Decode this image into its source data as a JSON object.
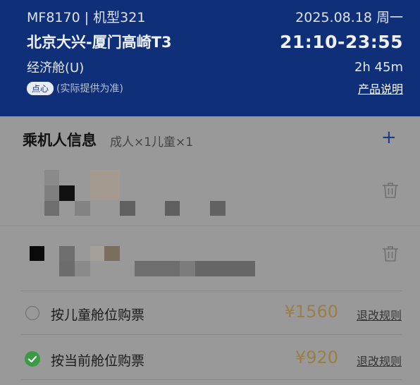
{
  "flight": {
    "number_model": "MF8170 | 机型321",
    "date": "2025.08.18 周一",
    "route": "北京大兴-厦门高崎T3",
    "time": "21:10-23:55",
    "cabin": "经济舱(U)",
    "duration": "2h 45m",
    "meal_badge": "点心",
    "meal_note": "(实际提供为准)",
    "product_link": "产品说明"
  },
  "passengers": {
    "title": "乘机人信息",
    "summary": "成人×1儿童×1",
    "add_icon": "plus-icon",
    "delete_icon": "trash-icon"
  },
  "options": [
    {
      "label": "按儿童舱位购票",
      "price": "¥1560",
      "rules": "退改规则",
      "selected": false
    },
    {
      "label": "按当前舱位购票",
      "price": "¥920",
      "rules": "退改规则",
      "selected": true
    }
  ],
  "colors": {
    "header_bg": "#0f2f79",
    "price": "#9a7e46",
    "selected": "#3a9a45",
    "accent": "#1e3a80"
  }
}
